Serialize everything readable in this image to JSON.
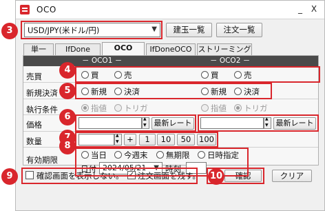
{
  "window": {
    "title": "OCO",
    "minimize": "_",
    "close": "X"
  },
  "badges": [
    "3",
    "4",
    "5",
    "6",
    "7",
    "8",
    "9",
    "10"
  ],
  "currency": {
    "value": "USD/JPY(米ドル/円)"
  },
  "top_buttons": {
    "positions": "建玉一覧",
    "orders": "注文一覧"
  },
  "tabs": [
    "単一",
    "IfDone",
    "OCO",
    "IfDoneOCO",
    "ストリーミング"
  ],
  "columns": {
    "oco1": "－ OCO1 －",
    "oco2": "－ OCO2 －"
  },
  "rows": {
    "side": {
      "label": "売買",
      "buy": "買",
      "sell": "売"
    },
    "type": {
      "label": "新規決済",
      "new": "新規",
      "settle": "決済"
    },
    "cond": {
      "label": "執行条件",
      "limit": "指値",
      "trigger": "トリガ"
    },
    "price": {
      "label": "価格",
      "latest": "最新レート"
    },
    "qty": {
      "label": "数量",
      "plus": "+",
      "q1": "1",
      "q10": "10",
      "q50": "50",
      "q100": "100"
    },
    "expiry": {
      "label": "有効期限",
      "today": "当日",
      "week": "今週末",
      "indefinite": "無期限",
      "datetime": "日時指定",
      "date_label": "日付",
      "date_value": "2024/05/21",
      "time_label": "時刻"
    }
  },
  "footer": {
    "confirm_check": "確認画面を表示しない。",
    "keep_check": "注文画面を残す。",
    "confirm_btn": "確認",
    "clear_btn": "クリア"
  },
  "colors": {
    "accent": "#d9262c",
    "header": "#4a4a4a"
  }
}
